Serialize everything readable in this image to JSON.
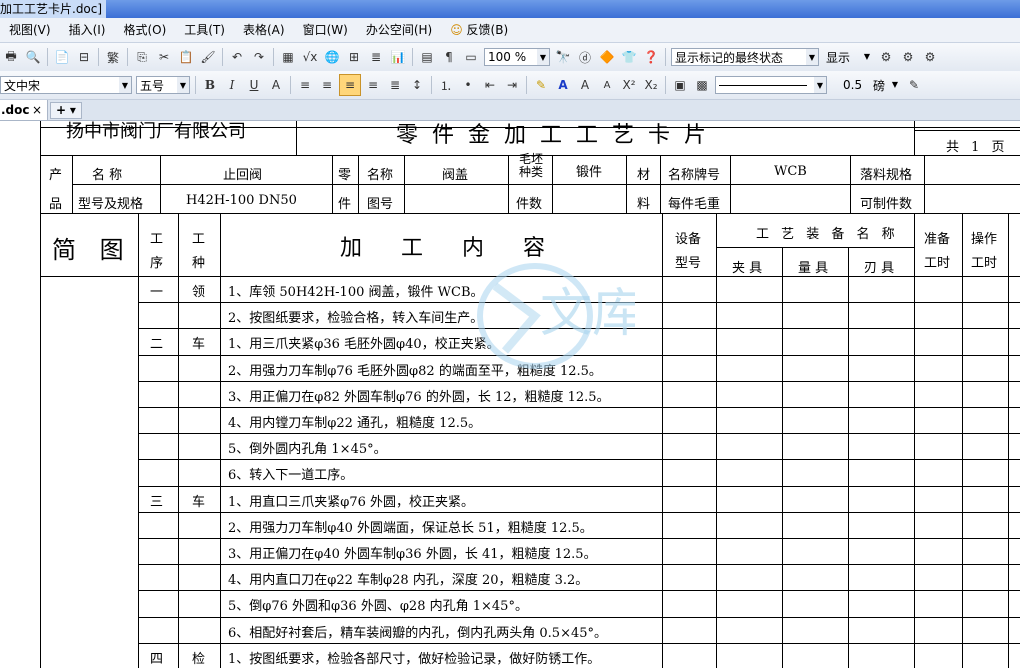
{
  "window": {
    "title": "加工工艺卡片.doc]"
  },
  "menu": [
    "视图(V)",
    "插入(I)",
    "格式(O)",
    "工具(T)",
    "表格(A)",
    "窗口(W)",
    "办公空间(H)",
    "反馈(B)"
  ],
  "toolbar1": {
    "zoom": "100 %",
    "markup_view": "显示标记的最终状态",
    "display_btn": "显示"
  },
  "toolbar2": {
    "font": "文中宋",
    "size": "五号",
    "line_width": "0.5",
    "line_unit": "磅"
  },
  "tab": {
    "name": ".doc",
    "close": "×",
    "new": "+"
  },
  "card": {
    "company": "扬中市阀门厂有限公司",
    "title": "零件金加工工艺卡片",
    "pages_total": "共 1 页",
    "head": {
      "chan": "产",
      "pin": "品",
      "mingcheng": "名  称",
      "product_name": "止回阀",
      "xinghao": "型号及规格",
      "product_model": "H42H-100 DN50",
      "ling": "零",
      "jian": "件",
      "part_name_label": "名称",
      "part_name": "阀盖",
      "drawing_label": "图号",
      "blank_type_label": "毛坯种类",
      "blank_type": "锻件",
      "qty_label": "件数",
      "cai": "材",
      "liao": "料",
      "material_label": "名称牌号",
      "material": "WCB",
      "weight_label": "每件毛重",
      "cut_spec_label": "落料规格",
      "pieces_label": "可制件数"
    },
    "cols": {
      "sketch": "简 图",
      "seq1": "工",
      "seq2": "序",
      "type1": "工",
      "type2": "种",
      "content": "加 工 内 容",
      "equip1": "设备",
      "equip2": "型号",
      "tooling": "工 艺 装 备 名 称",
      "fixture": "夹 具",
      "gauge": "量 具",
      "cutter": "刃 具",
      "prep1": "准备",
      "prep2": "工时",
      "op1": "操作",
      "op2": "工时"
    },
    "rows": [
      {
        "seq": "一",
        "type": "领",
        "text": "1、库领 50H42H-100 阀盖，锻件 WCB。"
      },
      {
        "seq": "",
        "type": "",
        "text": "2、按图纸要求，检验合格，转入车间生产。"
      },
      {
        "seq": "二",
        "type": "车",
        "text": "1、用三爪夹紧φ36 毛胚外圆φ40，校正夹紧。"
      },
      {
        "seq": "",
        "type": "",
        "text": "2、用强力刀车制φ76 毛胚外圆φ82 的端面至平，粗糙度 12.5。"
      },
      {
        "seq": "",
        "type": "",
        "text": "3、用正偏刀在φ82 外圆车制φ76 的外圆，长 12，粗糙度 12.5。"
      },
      {
        "seq": "",
        "type": "",
        "text": "4、用内镗刀车制φ22 通孔，粗糙度 12.5。"
      },
      {
        "seq": "",
        "type": "",
        "text": "5、倒外圆内孔角 1×45°。"
      },
      {
        "seq": "",
        "type": "",
        "text": "6、转入下一道工序。"
      },
      {
        "seq": "三",
        "type": "车",
        "text": "1、用直口三爪夹紧φ76 外圆，校正夹紧。"
      },
      {
        "seq": "",
        "type": "",
        "text": "2、用强力刀车制φ40 外圆端面，保证总长 51，粗糙度 12.5。"
      },
      {
        "seq": "",
        "type": "",
        "text": "3、用正偏刀在φ40 外圆车制φ36 外圆，长 41，粗糙度 12.5。"
      },
      {
        "seq": "",
        "type": "",
        "text": "4、用内直口刀在φ22 车制φ28 内孔，深度 20，粗糙度 3.2。"
      },
      {
        "seq": "",
        "type": "",
        "text": "5、倒φ76 外圆和φ36 外圆、φ28 内孔角 1×45°。"
      },
      {
        "seq": "",
        "type": "",
        "text": "6、相配好衬套后，精车装阀瓣的内孔，倒内孔两头角 0.5×45°。"
      },
      {
        "seq": "四",
        "type": "检",
        "text": "1、按图纸要求，检验各部尺寸，做好检验记录，做好防锈工作。"
      }
    ],
    "watermark": "文库"
  },
  "colors": {
    "watermark": "#a8d4ee",
    "titlebar": "#3b6fd6"
  }
}
